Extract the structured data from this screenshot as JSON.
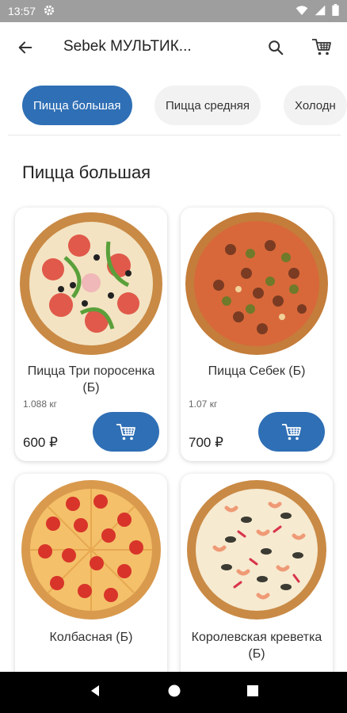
{
  "status_bar": {
    "time": "13:57"
  },
  "app_bar": {
    "title": "Sebek МУЛЬТИК..."
  },
  "tabs": [
    {
      "label": "Пицца большая"
    },
    {
      "label": "Пицца средняя"
    },
    {
      "label": "Холодн"
    }
  ],
  "section": {
    "title": "Пицца большая"
  },
  "products": [
    {
      "name": "Пицца Три поросенка (Б)",
      "weight": "1.088 кг",
      "price": "600 ₽"
    },
    {
      "name": "Пицца Себек (Б)",
      "weight": "1.07 кг",
      "price": "700 ₽"
    },
    {
      "name": "Колбасная (Б)"
    },
    {
      "name": "Королевская креветка (Б)"
    }
  ],
  "colors": {
    "accent": "#2f6fb5",
    "status_bar": "#9e9e9e",
    "nav_bar": "#000000"
  }
}
